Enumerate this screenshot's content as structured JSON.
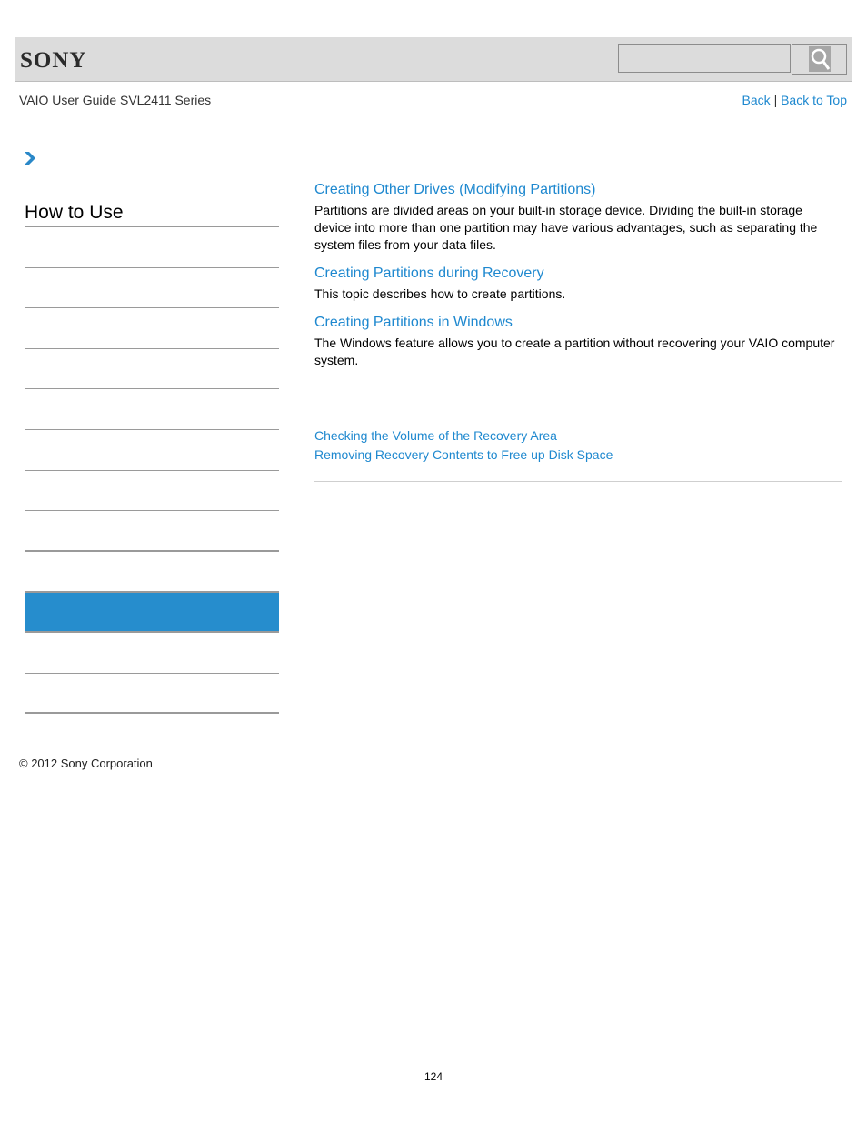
{
  "header": {
    "brand": "SONY",
    "search": {
      "placeholder": "",
      "value": ""
    },
    "search_icon": "magnifier-icon"
  },
  "subheader": {
    "guide_title": "VAIO User Guide SVL2411 Series",
    "back_label": "Back",
    "separator": "|",
    "back_to_top_label": "Back to Top"
  },
  "breadcrumb": {
    "icon": "chevron-right-icon"
  },
  "sidebar": {
    "title": "How to Use",
    "items": [
      {
        "label": "",
        "active": false
      },
      {
        "label": "",
        "active": false
      },
      {
        "label": "",
        "active": false
      },
      {
        "label": "",
        "active": false
      },
      {
        "label": "",
        "active": false
      },
      {
        "label": "",
        "active": false
      },
      {
        "label": "",
        "active": false
      },
      {
        "label": "",
        "active": false
      },
      {
        "label": "",
        "active": false
      },
      {
        "label": "",
        "active": true
      },
      {
        "label": "",
        "active": false
      },
      {
        "label": "",
        "active": false
      }
    ],
    "active_color": "#268dcd"
  },
  "main": {
    "topics": [
      {
        "title": "Creating Other Drives (Modifying Partitions)",
        "description": "Partitions are divided areas on your built-in storage device. Dividing the built-in storage device into more than one partition may have various advantages, such as separating the system files from your data files."
      },
      {
        "title": "Creating Partitions during Recovery",
        "description": "This topic describes how to create partitions."
      },
      {
        "title": "Creating Partitions in Windows",
        "description": "The Windows feature allows you to create a partition without recovering your VAIO computer system."
      }
    ],
    "related_links": [
      "Checking the Volume of the Recovery Area",
      "Removing Recovery Contents to Free up Disk Space"
    ]
  },
  "footer": {
    "copyright": "© 2012 Sony Corporation",
    "page_number": "124"
  },
  "colors": {
    "link": "#1e88cf",
    "header_bg": "#dcdcdc"
  }
}
